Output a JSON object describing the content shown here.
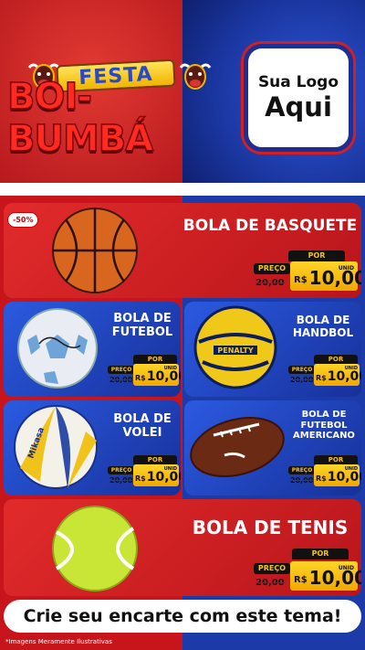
{
  "header": {
    "title_top": "FESTA",
    "title_main": "BOI-BUMBÁ",
    "logo_line1": "Sua Logo",
    "logo_line2": "Aqui"
  },
  "badge": "-50%",
  "products": [
    {
      "name_line1": "BOLA DE BASQUETE",
      "name_line2": "",
      "name_line3": "",
      "por": "POR",
      "preco": "PREÇO",
      "old_price": "20,00",
      "currency": "R$",
      "new_price": "10,00",
      "unit": "UNID",
      "icon": "basketball-icon"
    },
    {
      "name_line1": "BOLA DE",
      "name_line2": "FUTEBOL",
      "name_line3": "",
      "por": "POR",
      "preco": "PREÇO",
      "old_price": "20,00",
      "currency": "R$",
      "new_price": "10,00",
      "unit": "UNID",
      "icon": "soccer-ball-icon"
    },
    {
      "name_line1": "BOLA DE",
      "name_line2": "HANDBOL",
      "name_line3": "",
      "por": "POR",
      "preco": "PREÇO",
      "old_price": "20,00",
      "currency": "R$",
      "new_price": "10,00",
      "unit": "UNID",
      "icon": "handball-icon"
    },
    {
      "name_line1": "BOLA DE",
      "name_line2": "VOLEI",
      "name_line3": "",
      "por": "POR",
      "preco": "PREÇO",
      "old_price": "20,00",
      "currency": "R$",
      "new_price": "10,00",
      "unit": "UNID",
      "icon": "volleyball-icon"
    },
    {
      "name_line1": "BOLA DE",
      "name_line2": "FUTEBOL",
      "name_line3": "AMERICANO",
      "por": "POR",
      "preco": "PREÇO",
      "old_price": "20,00",
      "currency": "R$",
      "new_price": "10,00",
      "unit": "UNID",
      "icon": "american-football-icon"
    },
    {
      "name_line1": "BOLA DE TENIS",
      "name_line2": "",
      "name_line3": "",
      "por": "POR",
      "preco": "PREÇO",
      "old_price": "20,00",
      "currency": "R$",
      "new_price": "10,00",
      "unit": "UNID",
      "icon": "tennis-ball-icon"
    }
  ],
  "cta": "Crie seu encarte com este tema!",
  "footnote": "*Imagens Meramente Ilustrativas",
  "colors": {
    "red": "#c8151c",
    "blue": "#1c3aa8",
    "yellow": "#f6c21a",
    "logo_border": "#1c2f95"
  }
}
